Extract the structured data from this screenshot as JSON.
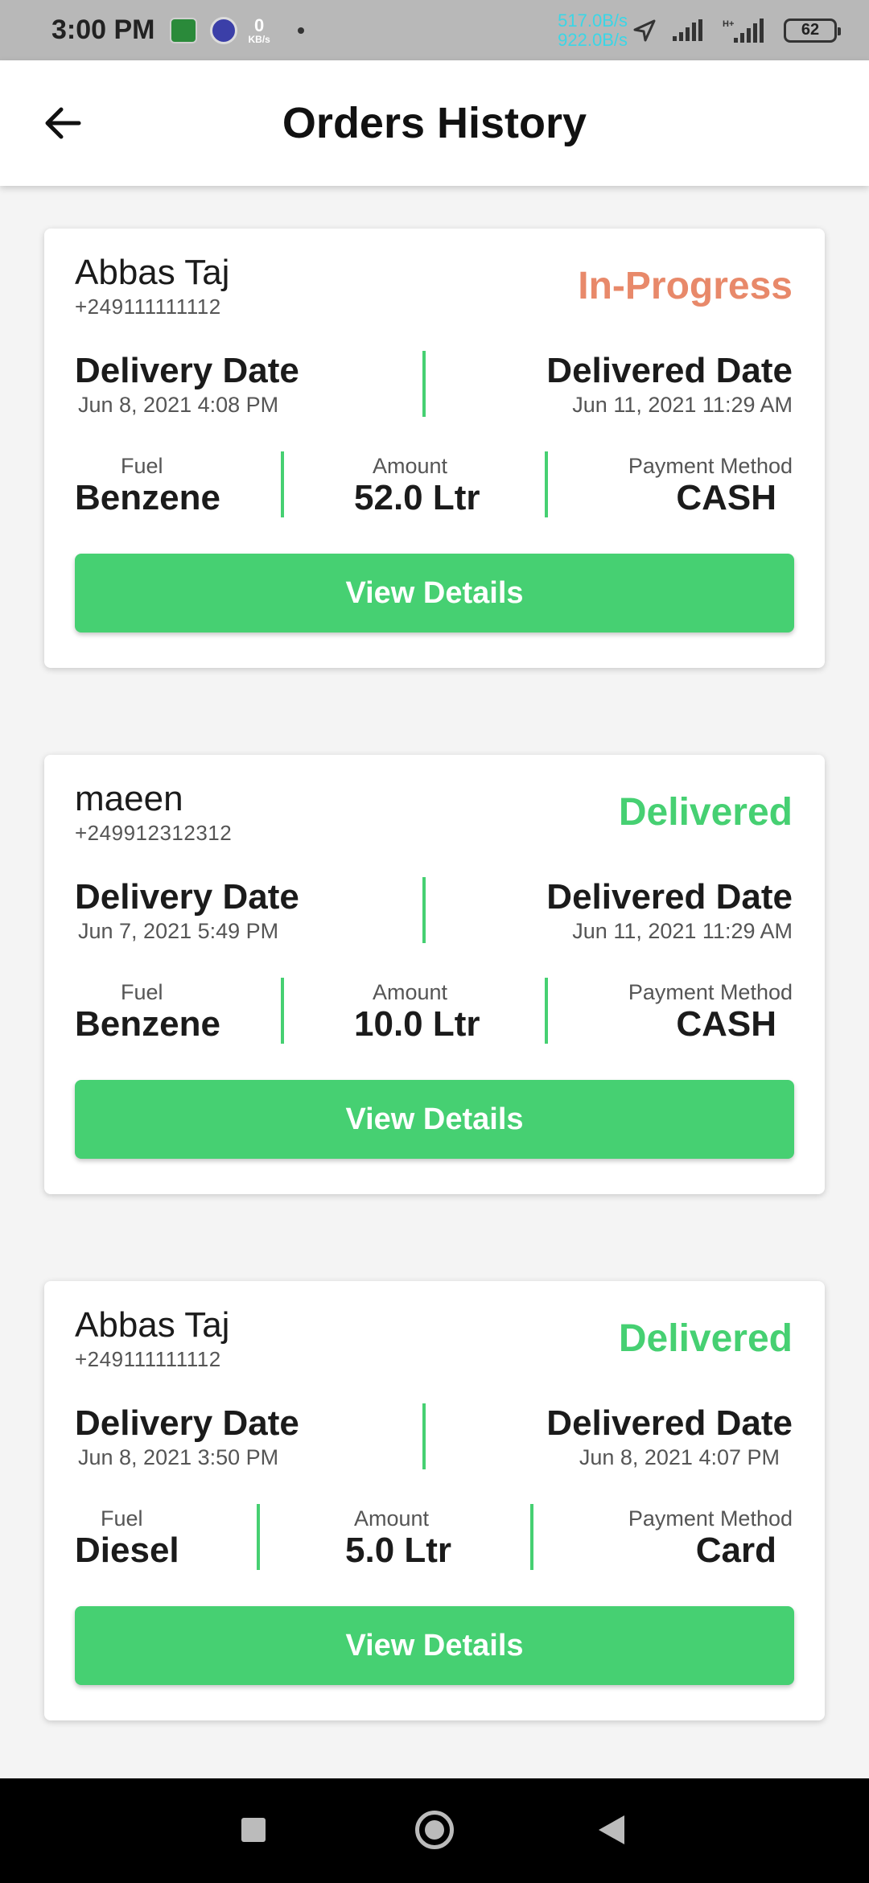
{
  "status_bar": {
    "time": "3:00 PM",
    "kb_value": "0",
    "kb_unit": "KB/s",
    "speed_up": "517.0B/s",
    "speed_down": "922.0B/s",
    "battery": "62"
  },
  "header": {
    "title": "Orders History",
    "back_icon": "arrow-left-icon"
  },
  "labels": {
    "delivery_date": "Delivery Date",
    "delivered_date": "Delivered Date",
    "fuel": "Fuel",
    "amount": "Amount",
    "payment_method": "Payment Method",
    "view_details": "View Details"
  },
  "colors": {
    "accent": "#46d072",
    "in_progress": "#e8896a",
    "delivered": "#46d072"
  },
  "orders": [
    {
      "name": "Abbas Taj",
      "phone": "+249111111112",
      "status": "In-Progress",
      "delivery_date": "Jun 8, 2021 4:08 PM",
      "delivered_date": "Jun 11, 2021 11:29 AM",
      "fuel": "Benzene",
      "amount": "52.0 Ltr",
      "payment_method": "CASH"
    },
    {
      "name": "maeen",
      "phone": "+249912312312",
      "status": "Delivered",
      "delivery_date": "Jun 7, 2021 5:49 PM",
      "delivered_date": "Jun 11, 2021 11:29 AM",
      "fuel": "Benzene",
      "amount": "10.0 Ltr",
      "payment_method": "CASH"
    },
    {
      "name": "Abbas Taj",
      "phone": "+249111111112",
      "status": "Delivered",
      "delivery_date": "Jun 8, 2021 3:50 PM",
      "delivered_date": "Jun 8, 2021 4:07 PM",
      "fuel": "Diesel",
      "amount": "5.0 Ltr",
      "payment_method": "Card"
    }
  ],
  "nav_bar": {
    "recents_icon": "square-icon",
    "home_icon": "circle-home-icon",
    "back_icon": "triangle-back-icon"
  }
}
